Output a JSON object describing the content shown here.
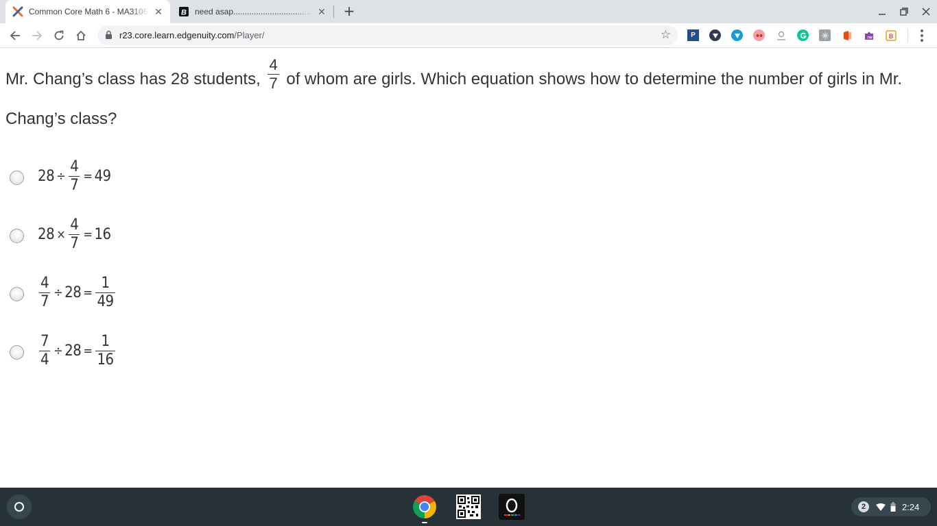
{
  "browser": {
    "tabs": [
      {
        "title": "Common Core Math 6 - MA3106",
        "favicon": "edgenuity-x-icon",
        "active": true
      },
      {
        "title": "need asap.......................................",
        "favicon": "brainly-b-icon",
        "active": false
      }
    ],
    "address": {
      "host": "r23.core.learn.edgenuity.com",
      "path": "/Player/"
    },
    "extensions": [
      "P",
      "shield-icon",
      "heart-shield-icon",
      "face-icon",
      "person-icon",
      "grammarly-icon",
      "puzzle-gray-icon",
      "office-icon",
      "puzzle-purple-icon",
      "fw-icon"
    ]
  },
  "question": {
    "before": "Mr. Chang’s class has 28 students,",
    "fraction": {
      "num": "4",
      "den": "7"
    },
    "after": "of whom are girls. Which equation shows how to determine the number of girls in Mr. Chang’s class?"
  },
  "options": [
    {
      "a": "28",
      "op": "÷",
      "frac_num": "4",
      "frac_den": "7",
      "eq": "=",
      "result": "49"
    },
    {
      "a": "28",
      "op": "×",
      "frac_num": "4",
      "frac_den": "7",
      "eq": "=",
      "result": "16"
    },
    {
      "frac_num": "4",
      "frac_den": "7",
      "op": "÷",
      "b": "28",
      "eq": "=",
      "res_num": "1",
      "res_den": "49"
    },
    {
      "frac_num": "7",
      "frac_den": "4",
      "op": "÷",
      "b": "28",
      "eq": "=",
      "res_num": "1",
      "res_den": "16"
    }
  ],
  "shelf": {
    "notification_count": "2",
    "time": "2:24"
  },
  "colors": {
    "tabstrip": "#dee1e6",
    "shelf": "#263238",
    "text": "#333333"
  }
}
